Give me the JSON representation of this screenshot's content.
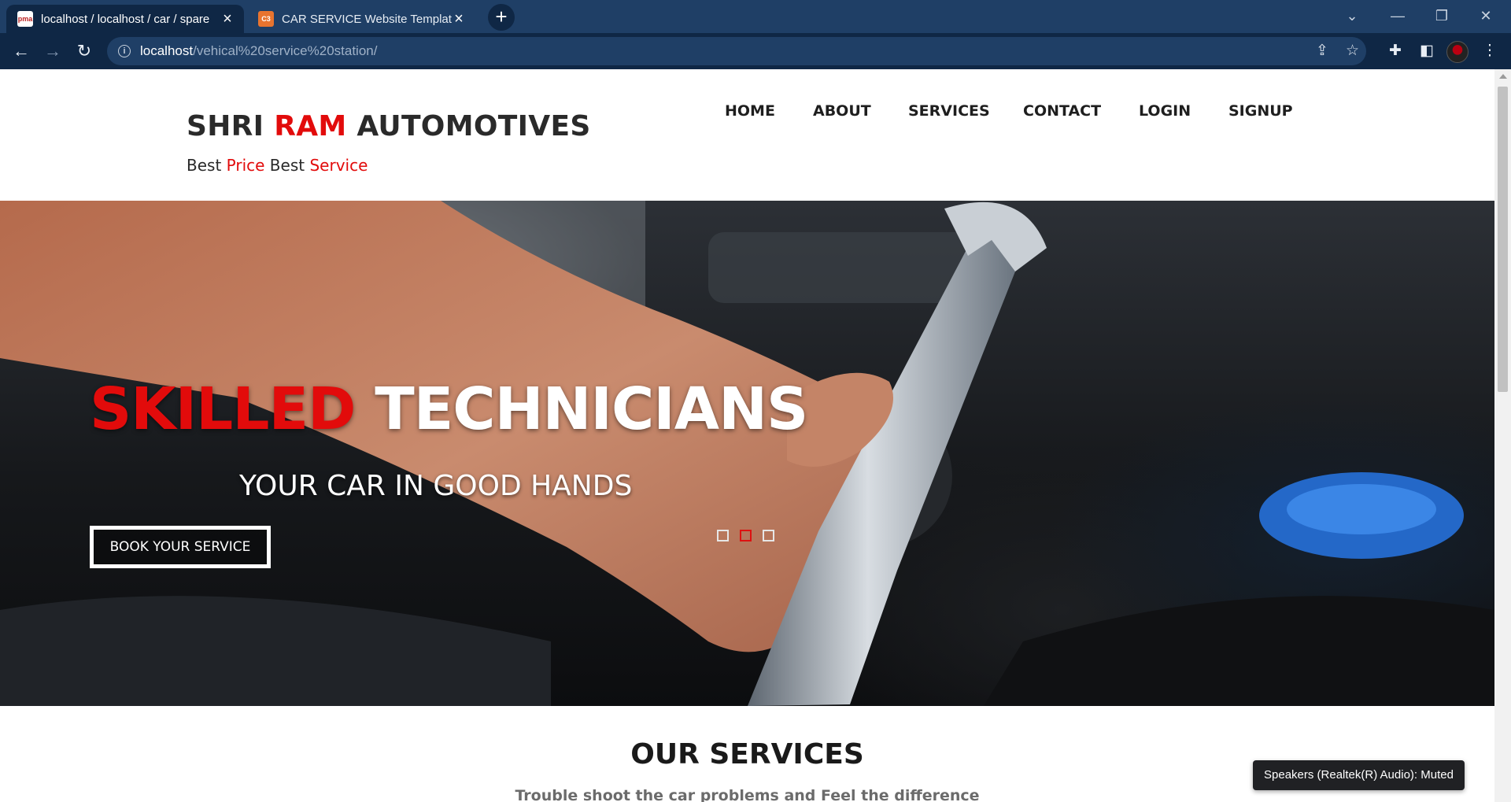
{
  "browser": {
    "tabs": [
      {
        "title": "localhost / localhost / car / spare",
        "favicon": "phpmyadmin-favicon-icon",
        "active": true
      },
      {
        "title": "CAR SERVICE Website Template |",
        "favicon": "template-favicon-icon",
        "active": false
      }
    ],
    "new_tab": "+",
    "url_host": "localhost",
    "url_path": "/vehical%20service%20station/"
  },
  "site": {
    "brand": {
      "part1": "SHRI ",
      "part2": "RAM",
      "part3": " AUTOMOTIVES"
    },
    "tagline": {
      "w1": "Best ",
      "w2": "Price",
      "w3": " Best ",
      "w4": "Service"
    },
    "nav": [
      "HOME",
      "ABOUT",
      "SERVICES",
      "CONTACT",
      "LOGIN",
      "SIGNUP"
    ],
    "hero": {
      "title_red": "SKILLED",
      "title_white": "TECHNICIANS",
      "subtitle": "YOUR CAR IN GOOD HANDS",
      "button": "BOOK YOUR SERVICE",
      "slides": 3,
      "active_slide": 2
    },
    "services": {
      "title": "OUR SERVICES",
      "subtitle": "Trouble shoot the car problems and Feel the difference"
    }
  },
  "toast": "Speakers (Realtek(R) Audio): Muted",
  "colors": {
    "accent": "#e20b0b",
    "chrome_dark": "#0f2745",
    "chrome_tab_strip": "#1f3f66"
  }
}
